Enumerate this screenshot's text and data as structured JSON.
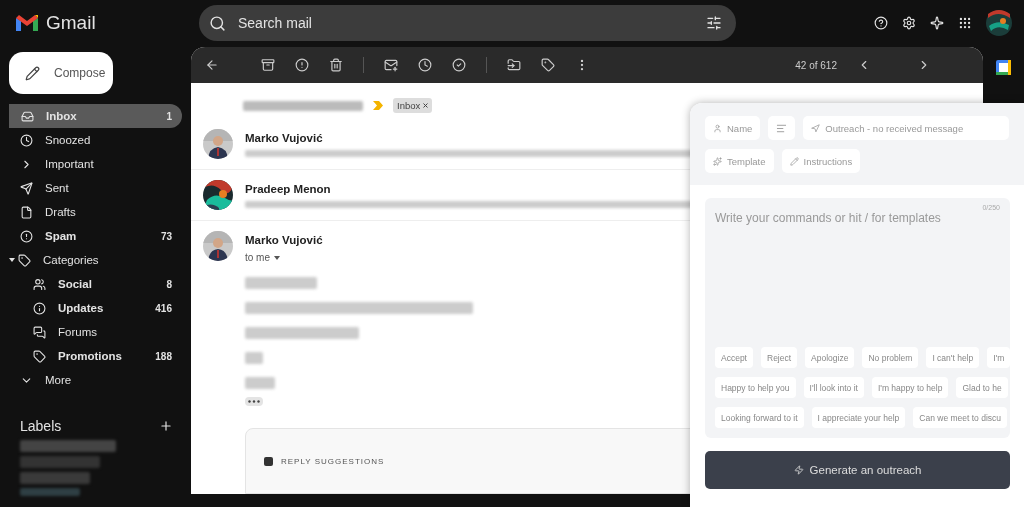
{
  "app": {
    "name": "Gmail"
  },
  "search": {
    "placeholder": "Search mail"
  },
  "compose": {
    "label": "Compose"
  },
  "nav": [
    {
      "label": "Inbox",
      "count": "1",
      "bold": true,
      "selected": true
    },
    {
      "label": "Snoozed",
      "bold": false,
      "selected": false
    },
    {
      "label": "Important",
      "bold": false,
      "selected": false
    },
    {
      "label": "Sent",
      "bold": false,
      "selected": false
    },
    {
      "label": "Drafts",
      "bold": false,
      "selected": false
    },
    {
      "label": "Spam",
      "count": "73",
      "bold": true,
      "selected": false
    },
    {
      "label": "Categories",
      "bold": false,
      "selected": false,
      "expanded": true,
      "children": [
        {
          "label": "Social",
          "count": "8",
          "bold": true,
          "selected": false
        },
        {
          "label": "Updates",
          "count": "416",
          "bold": true,
          "selected": false
        },
        {
          "label": "Forums",
          "bold": false,
          "selected": false
        },
        {
          "label": "Promotions",
          "count": "188",
          "bold": true,
          "selected": false
        }
      ]
    },
    {
      "label": "More",
      "bold": false,
      "selected": false
    }
  ],
  "labels": {
    "title": "Labels"
  },
  "toolbar": {
    "pager": "42 of 612"
  },
  "thread": {
    "label": "Inbox",
    "messages": [
      {
        "sender": "Marko Vujović",
        "expanded": false
      },
      {
        "sender": "Pradeep Menon",
        "expanded": false
      },
      {
        "sender": "Marko Vujović",
        "expanded": true,
        "recipient": "to me"
      }
    ],
    "reply_suggestions": "REPLY SUGGESTIONS"
  },
  "assistant": {
    "name": "Name",
    "mode": "Outreach - no received message",
    "template": "Template",
    "instructions": "Instructions",
    "input": {
      "placeholder": "Write your commands or hit / for templates",
      "counter": "0/250"
    },
    "chips": [
      [
        "Accept",
        "Reject",
        "Apologize",
        "No problem",
        "I can't help",
        "I'm"
      ],
      [
        "Happy to help you",
        "I'll look into it",
        "I'm happy to help",
        "Glad to he"
      ],
      [
        "Looking forward to it",
        "I appreciate your help",
        "Can we meet to discu"
      ]
    ],
    "button": "Generate an outreach"
  }
}
